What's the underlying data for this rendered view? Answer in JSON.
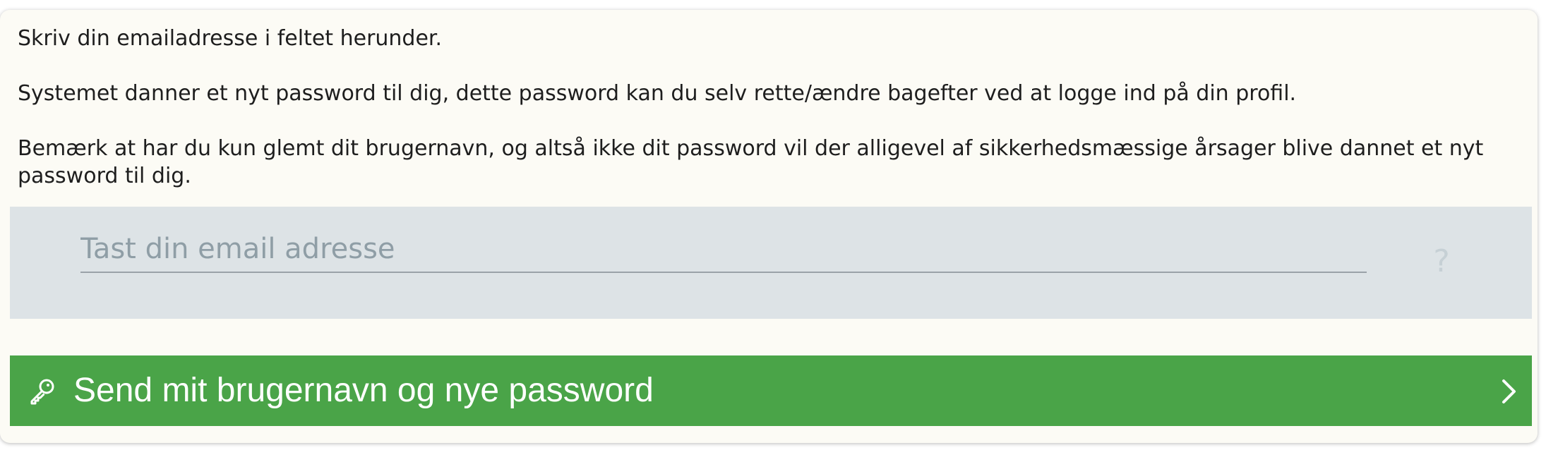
{
  "instructions": {
    "line1": "Skriv din emailadresse i feltet herunder.",
    "line2": "Systemet danner et nyt password til dig, dette password kan du selv rette/ændre bagefter ved at logge ind på din profil.",
    "line3": "Bemærk at har du kun glemt dit brugernavn, og altså ikke dit password vil der alligevel af sikkerhedsmæssige årsager blive dannet et nyt password til dig."
  },
  "email_field": {
    "placeholder": "Tast din email adresse",
    "value": "",
    "help_label": "?"
  },
  "submit_button": {
    "label": "Send mit brugernavn og nye password",
    "icon": "key-icon",
    "trailing_icon": "chevron-right-icon"
  },
  "colors": {
    "panel_background": "#fcfbf5",
    "input_background": "#dde3e6",
    "button_background": "#4aa448",
    "text": "#1e1e1e"
  }
}
